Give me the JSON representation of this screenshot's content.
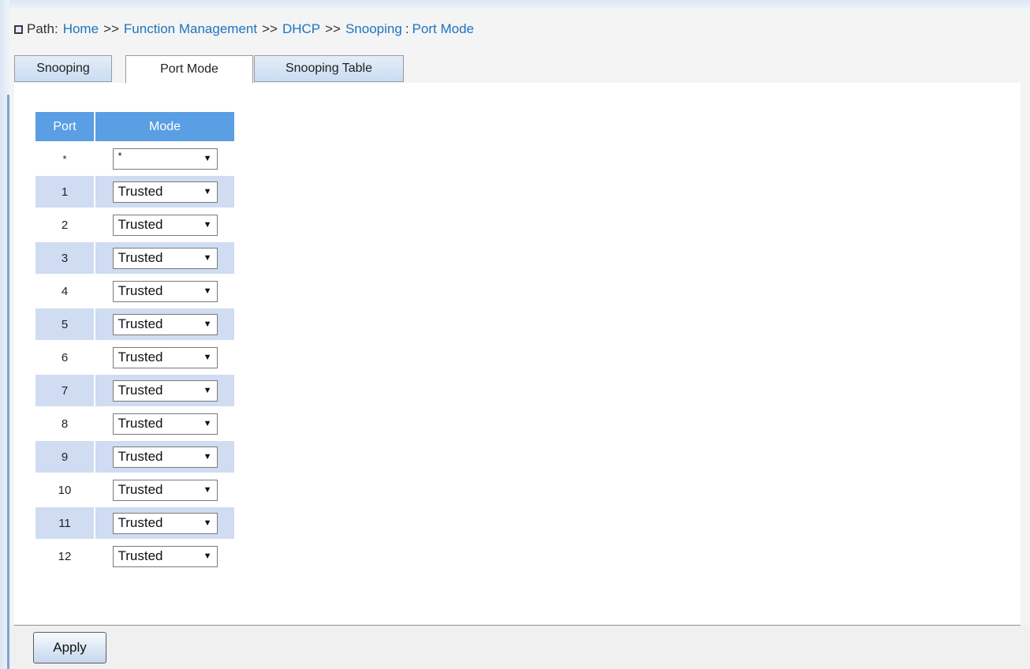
{
  "breadcrumb": {
    "label": "Path:",
    "items": [
      "Home",
      "Function Management",
      "DHCP",
      "Snooping"
    ],
    "separator": ">>",
    "current_separator": ":",
    "current": "Port Mode"
  },
  "tabs": [
    {
      "label": "Snooping",
      "active": false
    },
    {
      "label": "Port Mode",
      "active": true
    },
    {
      "label": "Snooping Table",
      "active": false
    }
  ],
  "table": {
    "headers": [
      "Port",
      "Mode"
    ],
    "rows": [
      {
        "port": "*",
        "mode": "*"
      },
      {
        "port": "1",
        "mode": "Trusted"
      },
      {
        "port": "2",
        "mode": "Trusted"
      },
      {
        "port": "3",
        "mode": "Trusted"
      },
      {
        "port": "4",
        "mode": "Trusted"
      },
      {
        "port": "5",
        "mode": "Trusted"
      },
      {
        "port": "6",
        "mode": "Trusted"
      },
      {
        "port": "7",
        "mode": "Trusted"
      },
      {
        "port": "8",
        "mode": "Trusted"
      },
      {
        "port": "9",
        "mode": "Trusted"
      },
      {
        "port": "10",
        "mode": "Trusted"
      },
      {
        "port": "11",
        "mode": "Trusted"
      },
      {
        "port": "12",
        "mode": "Trusted"
      }
    ]
  },
  "footer": {
    "apply_label": "Apply"
  },
  "colors": {
    "header_blue": "#5a9ee3",
    "row_stripe": "#cfdcf2",
    "link": "#1e73be"
  }
}
